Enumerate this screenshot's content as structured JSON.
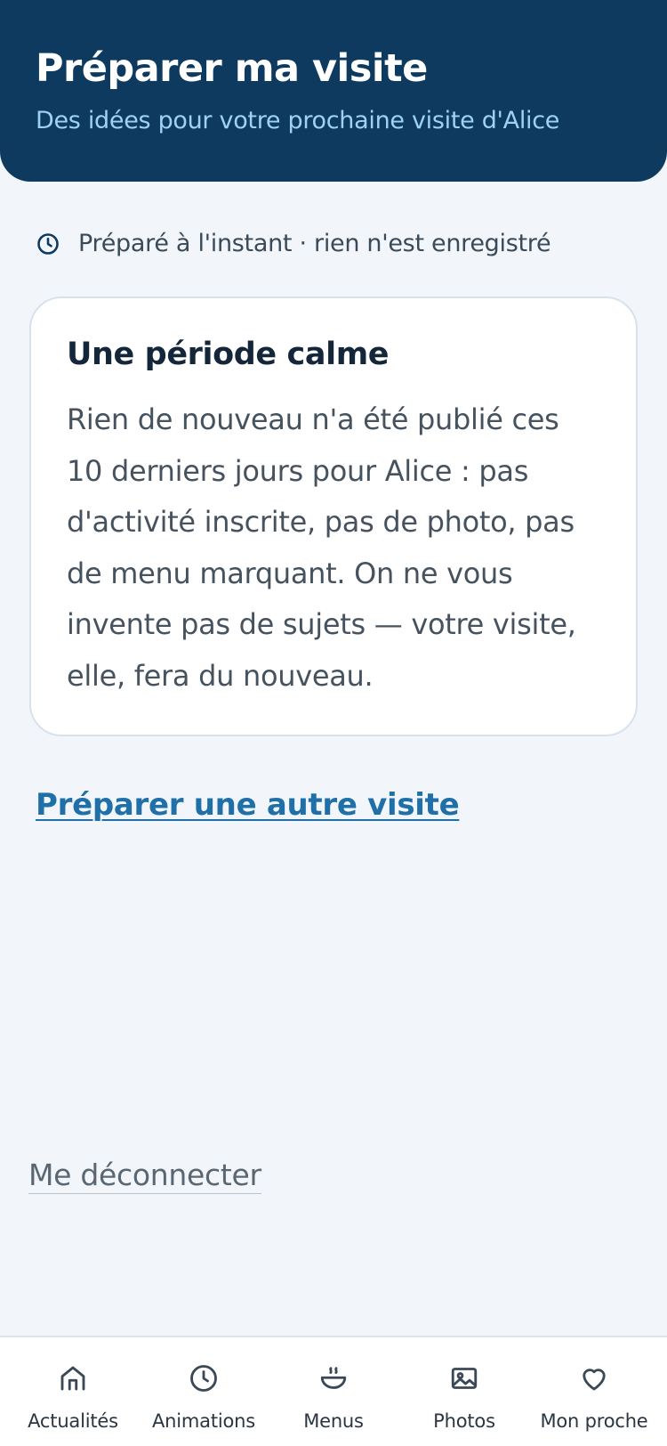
{
  "header": {
    "title": "Préparer ma visite",
    "subtitle": "Des idées pour votre prochaine visite d'Alice"
  },
  "status": {
    "icon": "clock-icon",
    "text": "Préparé à l'instant · rien n'est enregistré"
  },
  "card": {
    "title": "Une période calme",
    "body": "Rien de nouveau n'a été publié ces 10 derniers jours pour Alice : pas d'activité inscrite, pas de photo, pas de menu marquant. On ne vous invente pas de sujets — votre visite, elle, fera du nouveau."
  },
  "actions": {
    "other_visit": "Préparer une autre visite",
    "logout": "Me déconnecter"
  },
  "nav": {
    "items": [
      {
        "label": "Actualités",
        "icon": "home-icon"
      },
      {
        "label": "Animations",
        "icon": "clock-icon"
      },
      {
        "label": "Menus",
        "icon": "bowl-icon"
      },
      {
        "label": "Photos",
        "icon": "image-icon"
      },
      {
        "label": "Mon proche",
        "icon": "heart-icon"
      }
    ]
  },
  "colors": {
    "header_bg": "#0f3a5f",
    "subtitle": "#9dd2f5",
    "link": "#1f6fa8",
    "page_bg": "#f2f6fa"
  }
}
